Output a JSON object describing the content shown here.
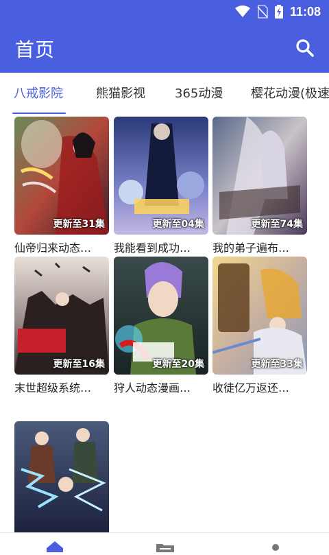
{
  "status_bar": {
    "time": "11:08",
    "icons": [
      "wifi-icon",
      "no-sim-icon",
      "battery-charging-icon"
    ]
  },
  "app_bar": {
    "title": "首页",
    "search_icon": "search-icon",
    "color": "#4a5fe0"
  },
  "tabs": [
    {
      "label": "八戒影院",
      "active": true
    },
    {
      "label": "熊猫影视",
      "active": false
    },
    {
      "label": "365动漫",
      "active": false
    },
    {
      "label": "樱花动漫(极速",
      "active": false
    }
  ],
  "items": [
    {
      "title": "仙帝归来动态…",
      "badge": "更新至31集"
    },
    {
      "title": "我能看到成功…",
      "badge": "更新至04集"
    },
    {
      "title": "我的弟子遍布…",
      "badge": "更新至74集"
    },
    {
      "title": "末世超级系统…",
      "badge": "更新至16集"
    },
    {
      "title": "狩人动态漫画…",
      "badge": "更新至20集"
    },
    {
      "title": "收徒亿万返还…",
      "badge": "更新至33集"
    },
    {
      "title": "",
      "badge": ""
    }
  ],
  "bottom_nav": [
    {
      "icon": "home-icon",
      "active": true
    },
    {
      "icon": "folder-icon",
      "active": false
    },
    {
      "icon": "profile-icon",
      "active": false
    }
  ]
}
